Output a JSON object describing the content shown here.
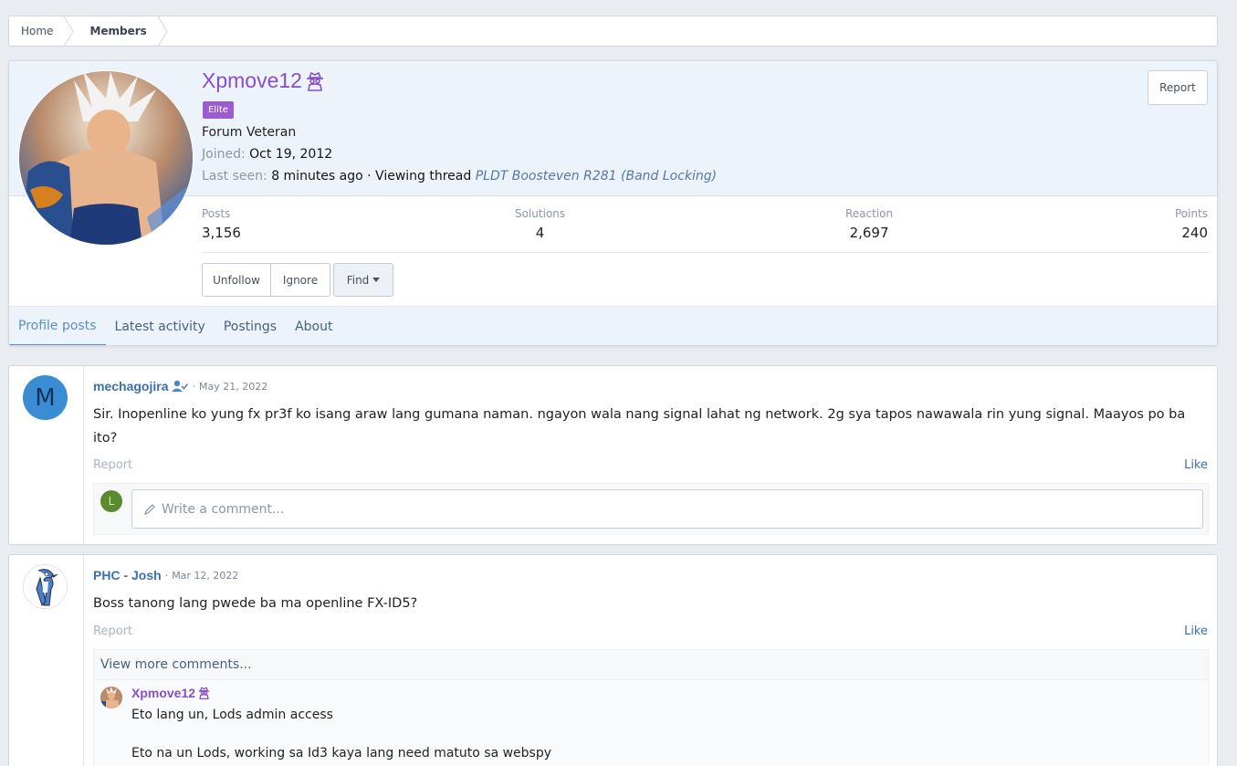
{
  "breadcrumb": {
    "home": "Home",
    "members": "Members"
  },
  "profile": {
    "username": "Xpmove12",
    "badge": "Elite",
    "user_title": "Forum Veteran",
    "joined_label": "Joined:",
    "joined_value": "Oct 19, 2012",
    "last_seen_label": "Last seen:",
    "last_seen_value": "8 minutes ago · Viewing thread",
    "last_seen_thread": "PLDT Boosteven R281 (Band Locking)",
    "report_label": "Report",
    "stats": [
      {
        "label": "Posts",
        "value": "3,156"
      },
      {
        "label": "Solutions",
        "value": "4"
      },
      {
        "label": "Reaction",
        "value": "2,697"
      },
      {
        "label": "Points",
        "value": "240"
      }
    ],
    "buttons": {
      "unfollow": "Unfollow",
      "ignore": "Ignore",
      "find": "Find"
    },
    "tabs": [
      "Profile posts",
      "Latest activity",
      "Postings",
      "About"
    ]
  },
  "posts": [
    {
      "avatar_letter": "M",
      "author": "mechagojira",
      "date": "May 21, 2022",
      "body": "Sir. Inopenline ko yung fx pr3f ko isang araw lang gumana naman. ngayon wala nang signal lahat ng network. 2g sya tapos nawawala rin yung signal. Maayos po ba ito?",
      "report": "Report",
      "like": "Like",
      "comment_avatar_letter": "L",
      "comment_placeholder": "Write a comment..."
    },
    {
      "author": "PHC - Josh",
      "date": "Mar 12, 2022",
      "body": "Boss tanong lang pwede ba ma openline FX-ID5?",
      "report": "Report",
      "like": "Like",
      "view_more": "View more comments...",
      "reply": {
        "author": "Xpmove12",
        "line1": "Eto lang un, Lods admin access",
        "line2": "Eto na un Lods, working sa Id3 kaya lang need matuto sa webspy"
      }
    }
  ],
  "colors": {
    "accent": "#5b8fc6",
    "username": "#8a4fc7",
    "link": "#3b6faf"
  }
}
